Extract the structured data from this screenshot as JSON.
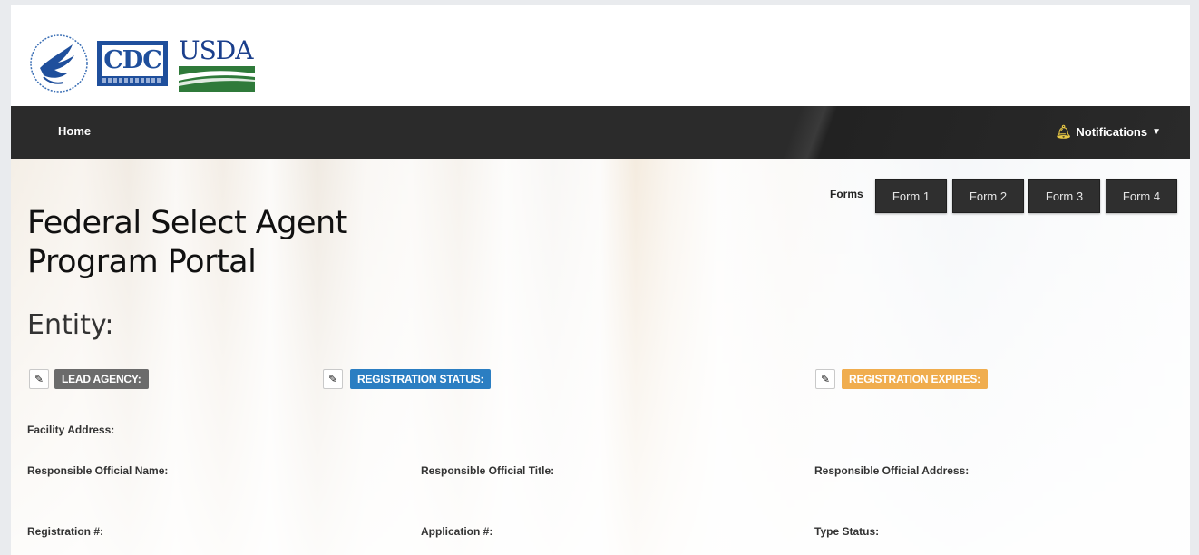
{
  "header": {
    "logos": {
      "hhs": "hhs-eagle-logo",
      "cdc": "CDC",
      "usda": "USDA"
    }
  },
  "navbar": {
    "home_label": "Home",
    "notifications_label": "Notifications"
  },
  "forms": {
    "label": "Forms",
    "buttons": [
      "Form 1",
      "Form 2",
      "Form 3",
      "Form 4"
    ]
  },
  "page": {
    "title_line1": "Federal Select Agent",
    "title_line2": "Program Portal",
    "entity_label": "Entity:"
  },
  "badges": {
    "lead_agency": "LEAD AGENCY:",
    "registration_status": "REGISTRATION STATUS:",
    "registration_expires": "REGISTRATION EXPIRES:"
  },
  "fields": {
    "facility_address": "Facility Address:",
    "ro_name": "Responsible Official Name:",
    "ro_title": "Responsible Official Title:",
    "ro_address": "Responsible Official Address:",
    "registration_no": "Registration #:",
    "application_no": "Application #:",
    "type_status": "Type Status:"
  },
  "colors": {
    "navbar": "#2b2b2b",
    "badge_gray": "#6b6b6b",
    "badge_blue": "#2b7ec2",
    "badge_orange": "#f0ad4e",
    "bell": "#e8c845"
  }
}
